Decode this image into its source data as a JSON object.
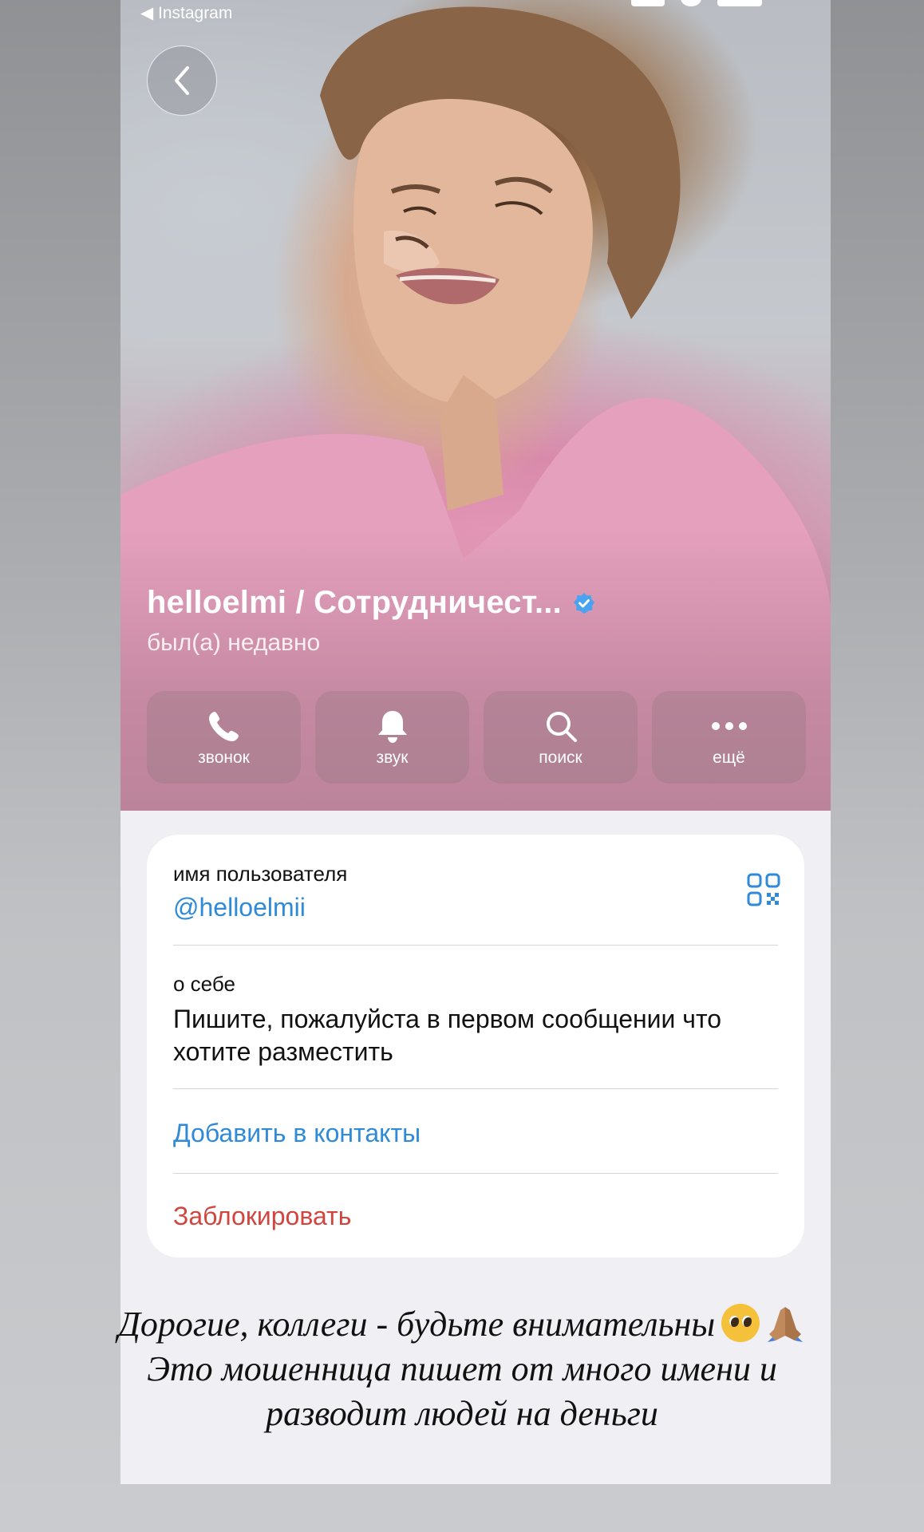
{
  "status_bar": {
    "back_app": "◀ Instagram"
  },
  "profile": {
    "name": "helloelmi / Сотрудничест...",
    "last_seen": "был(а) недавно",
    "verified": true
  },
  "actions": [
    {
      "label": "звонок",
      "icon": "phone-icon"
    },
    {
      "label": "звук",
      "icon": "bell-icon"
    },
    {
      "label": "поиск",
      "icon": "search-icon"
    },
    {
      "label": "ещё",
      "icon": "more-icon"
    }
  ],
  "info": {
    "username_label": "имя пользователя",
    "username": "@helloelmii",
    "bio_label": "о себе",
    "bio": "Пишите, пожалуйста в первом сообщении что хотите разместить",
    "add_contact": "Добавить в контакты",
    "block": "Заблокировать"
  },
  "caption": {
    "line1": "Дорогие, коллеги - будьте внимательны",
    "line2": "Это мошенница пишет от много имени и",
    "line3": "разводит людей на деньги",
    "emojis": [
      "pleading-face-emoji",
      "folded-hands-emoji"
    ]
  },
  "colors": {
    "link_blue": "#2f8ad8",
    "danger_red": "#d2453f",
    "verified_blue": "#4aa3f0"
  }
}
